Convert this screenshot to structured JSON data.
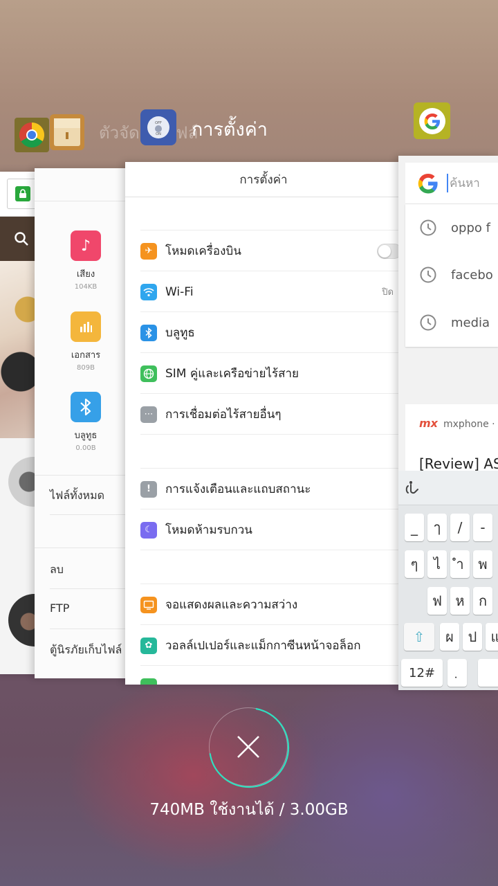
{
  "recents_header": {
    "faded_label": "ตัวจัดการไฟล์",
    "active_label": "การตั้งค่า",
    "settings_icon_top": "OFF",
    "settings_icon_bottom": "ON"
  },
  "file_manager": {
    "categories": [
      {
        "name": "เสียง",
        "size": "104KB",
        "color": "#f0476b",
        "icon": "music-note-icon"
      },
      {
        "name": "เอกสาร",
        "size": "809B",
        "color": "#f4b63c",
        "icon": "document-chart-icon"
      },
      {
        "name": "บลูทูธ",
        "size": "0.00B",
        "color": "#36a0e8",
        "icon": "bluetooth-icon"
      }
    ],
    "rows": [
      "ไฟล์ทั้งหมด",
      "ลบ",
      "FTP",
      "ตู้นิรภัยเก็บไฟล์"
    ]
  },
  "settings": {
    "title": "การตั้งค่า",
    "groups": [
      [
        {
          "label": "โหมดเครื่องบิน",
          "color": "#f5931f",
          "glyph": "✈",
          "icon": "airplane-icon",
          "toggle": true
        },
        {
          "label": "Wi-Fi",
          "color": "#2fa6ee",
          "glyph": "◠",
          "icon": "wifi-icon",
          "value": "ปิด"
        },
        {
          "label": "บลูทูธ",
          "color": "#2a92e6",
          "glyph": "ᛒ",
          "icon": "bluetooth-icon"
        },
        {
          "label": "SIM คู่และเครือข่ายไร้สาย",
          "color": "#3fbf5c",
          "glyph": "◉",
          "icon": "globe-icon"
        },
        {
          "label": "การเชื่อมต่อไร้สายอื่นๆ",
          "color": "#9aa0a6",
          "glyph": "⋯",
          "icon": "more-icon"
        }
      ],
      [
        {
          "label": "การแจ้งเตือนและแถบสถานะ",
          "color": "#9aa0a6",
          "glyph": "!",
          "icon": "notification-icon"
        },
        {
          "label": "โหมดห้ามรบกวน",
          "color": "#7a6cf0",
          "glyph": "☾",
          "icon": "moon-icon"
        }
      ],
      [
        {
          "label": "จอแสดงผลและความสว่าง",
          "color": "#f5931f",
          "glyph": "▭",
          "icon": "display-icon"
        },
        {
          "label": "วอลล์เปเปอร์และแม็กกาซีนหน้าจอล็อก",
          "color": "#26b89a",
          "glyph": "✿",
          "icon": "wallpaper-icon"
        }
      ]
    ]
  },
  "google": {
    "search_placeholder": "ค้นหา",
    "history": [
      "oppo f",
      "facebo",
      "media"
    ],
    "news_source": "mxphone ·",
    "news_logo": "mx",
    "news_headline": "[Review] AS"
  },
  "keyboard": {
    "row1": [
      "_",
      "ๅ",
      "/",
      "-"
    ],
    "row2": [
      "ๆ",
      "ไ",
      "ำ",
      "พ"
    ],
    "row3": [
      "ฟ",
      "ห",
      "ก"
    ],
    "row4": [
      "ผ",
      "ป",
      "แ"
    ],
    "mode_key": "12#",
    "alt_key": "ฺ"
  },
  "memory": {
    "text": "740MB  ใช้งานได้ /  3.00GB"
  }
}
